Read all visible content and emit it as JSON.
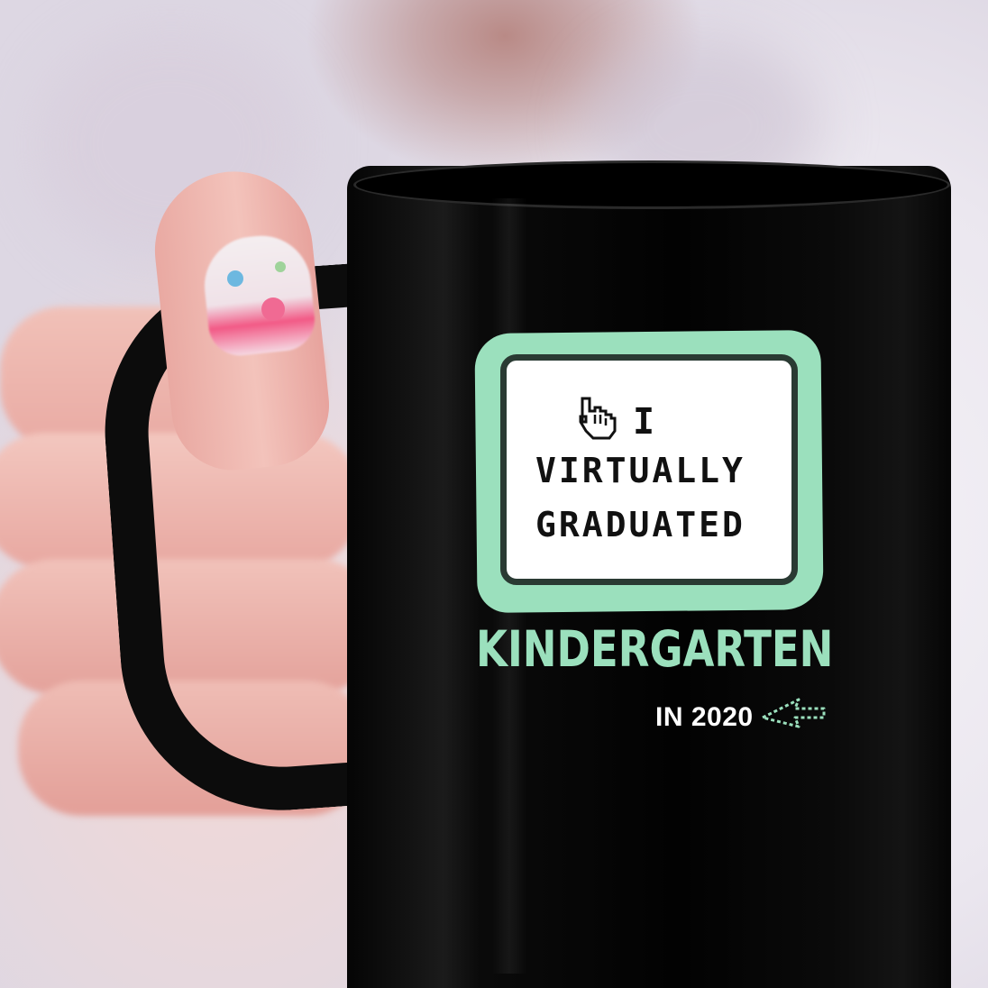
{
  "mug": {
    "line1": "I",
    "line2": "VIRTUALLY",
    "line3": "GRADUATED",
    "school": "KINDERGARTEN",
    "year": "IN 2020"
  },
  "colors": {
    "mint": "#9be0bd",
    "mug": "#0c0c0c",
    "screen": "#ffffff"
  },
  "icons": [
    "pointer-hand-icon",
    "cursor-arrow-icon"
  ]
}
